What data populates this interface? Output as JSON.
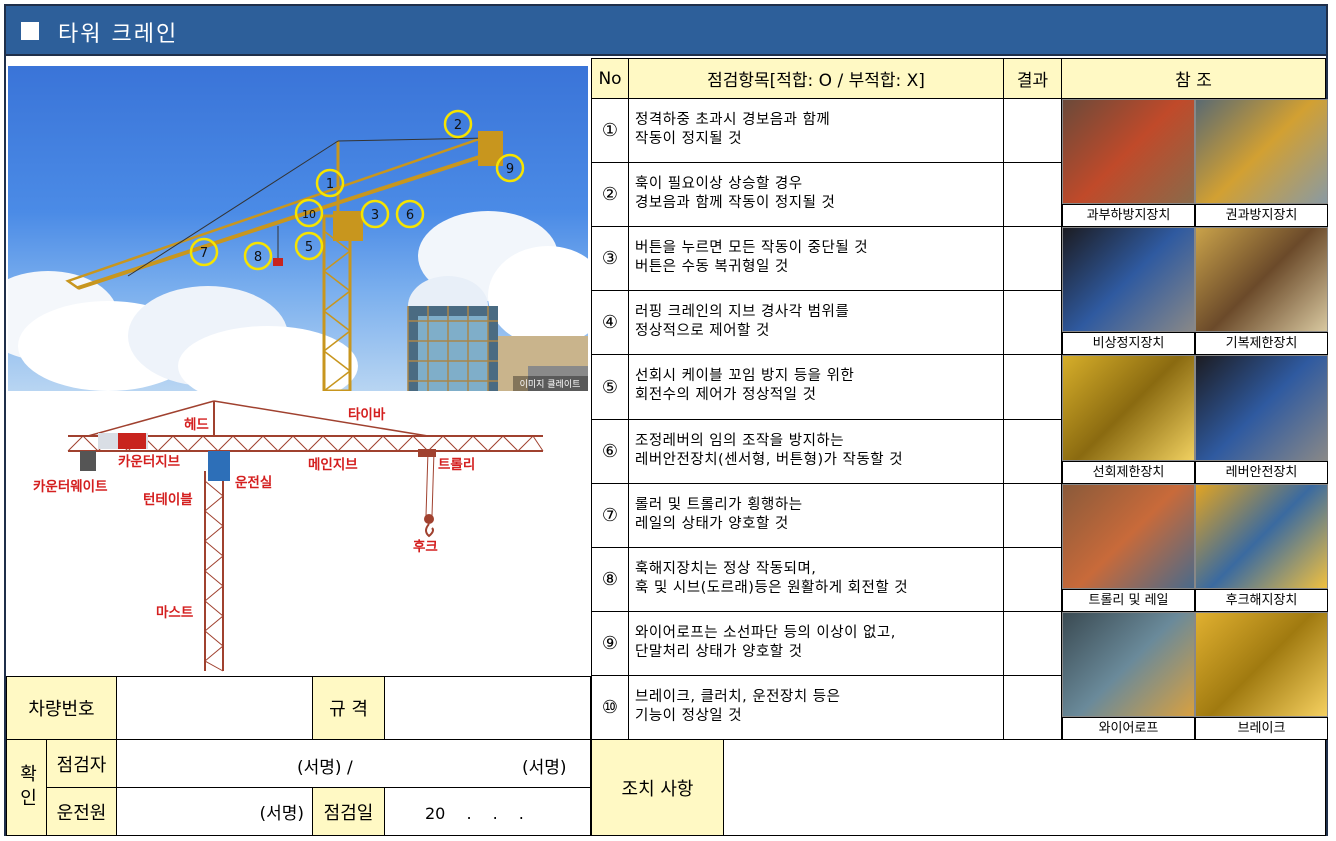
{
  "header": {
    "title": "타워 크레인"
  },
  "photo": {
    "markers": [
      "1",
      "2",
      "3",
      "5",
      "6",
      "7",
      "8",
      "9",
      "10"
    ],
    "watermark": "이미지 클레이트"
  },
  "diagram": {
    "labels": {
      "head": "헤드",
      "tiebar": "타이바",
      "counter_jib": "카운터지브",
      "main_jib": "메인지브",
      "trolley": "트롤리",
      "counterweight": "카운터웨이트",
      "cab": "운전실",
      "turntable": "턴테이블",
      "hook": "후크",
      "mast": "마스트"
    }
  },
  "form": {
    "vehicle_no_label": "차량번호",
    "spec_label": "규 격",
    "confirm_label": "확인",
    "inspector_label": "점검자",
    "inspector_sign": "(서명) /",
    "inspector_sign2": "(서명)",
    "operator_label": "운전원",
    "operator_sign": "(서명)",
    "date_label": "점검일",
    "date_value": "20　 .　 .　 ."
  },
  "table": {
    "col_no": "No",
    "col_item": "점검항목[적합: O / 부적합: X]",
    "col_result": "결과",
    "col_ref": "참 조",
    "rows": [
      {
        "no": "①",
        "line1": "정격하중 초과시 경보음과 함께",
        "line2": "작동이 정지될 것"
      },
      {
        "no": "②",
        "line1": "훅이 필요이상 상승할 경우",
        "line2": "경보음과 함께 작동이 정지될 것"
      },
      {
        "no": "③",
        "line1": "버튼을 누르면 모든 작동이 중단될 것",
        "line2": "버튼은 수동 복귀형일 것"
      },
      {
        "no": "④",
        "line1": "러핑 크레인의 지브 경사각 범위를",
        "line2": "정상적으로 제어할 것"
      },
      {
        "no": "⑤",
        "line1": "선회시 케이블 꼬임 방지 등을 위한",
        "line2": "회전수의 제어가 정상적일 것"
      },
      {
        "no": "⑥",
        "line1": "조정레버의 임의 조작을 방지하는",
        "line2": "레버안전장치(센서형, 버튼형)가 작동할 것"
      },
      {
        "no": "⑦",
        "line1": "롤러 및 트롤리가 횡행하는",
        "line2": "레일의 상태가 양호할 것"
      },
      {
        "no": "⑧",
        "line1": "훅해지장치는 정상 작동되며,",
        "line2": "훅 및 시브(도르래)등은 원활하게 회전할 것"
      },
      {
        "no": "⑨",
        "line1": "와이어로프는 소선파단 등의 이상이 없고,",
        "line2": "단말처리 상태가 양호할 것"
      },
      {
        "no": "⑩",
        "line1": "브레이크, 클러치, 운전장치 등은",
        "line2": "기능이 정상일 것"
      }
    ],
    "refs": [
      [
        "과부하방지장치",
        "권과방지장치"
      ],
      [
        "비상정지장치",
        "기복제한장치"
      ],
      [
        "선회제한장치",
        "레버안전장치"
      ],
      [
        "트롤리 및 레일",
        "후크해지장치"
      ],
      [
        "와이어로프",
        "브레이크"
      ]
    ]
  },
  "action": {
    "label": "조치 사항"
  }
}
